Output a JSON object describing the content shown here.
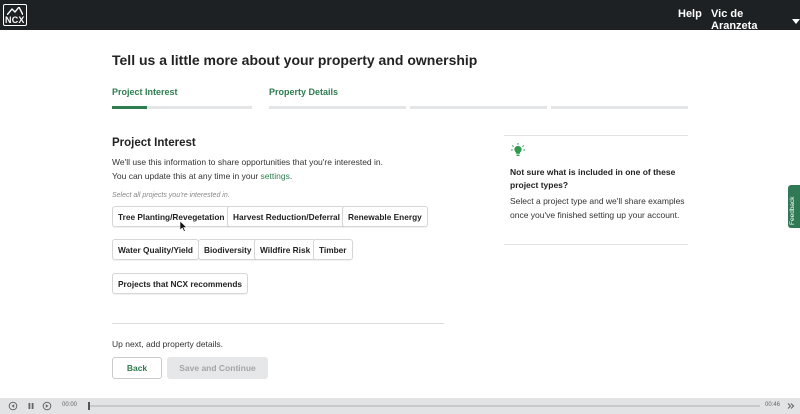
{
  "header": {
    "logo_text": "NCX",
    "help_label": "Help",
    "user_name": "Vic de Aranzeta"
  },
  "page": {
    "title": "Tell us a little more about your property and ownership"
  },
  "steps": [
    {
      "label": "Project Interest",
      "progress": 0.25
    },
    {
      "label": "Property Details",
      "progress": 0
    },
    {
      "label": "",
      "progress": 0
    },
    {
      "label": "",
      "progress": 0
    }
  ],
  "section": {
    "title": "Project Interest",
    "desc_line1": "We'll use this information to share opportunities that you're interested in.",
    "desc_line2_prefix": "You can update this at any time in your ",
    "desc_link": "settings",
    "desc_line2_suffix": ".",
    "hint": "Select all projects you're interested in."
  },
  "projects": [
    "Tree Planting/Revegetation",
    "Harvest Reduction/Deferral",
    "Renewable Energy",
    "Water Quality/Yield",
    "Biodiversity",
    "Wildfire Risk",
    "Timber",
    "Projects that NCX recommends"
  ],
  "footer": {
    "up_next": "Up next, add property details.",
    "back_label": "Back",
    "save_label": "Save and Continue"
  },
  "aside": {
    "icon": "lightbulb-icon",
    "title": "Not sure what is included in one of these project types?",
    "body": "Select a project type and we'll share examples once you've finished setting up your account."
  },
  "feedback_label": "Feedback",
  "player": {
    "current_time": "00:00",
    "duration": "00:46",
    "progress": 0
  },
  "colors": {
    "brand_green": "#2e7d4f",
    "topbar": "#1d2124",
    "feedback_tab": "#2f7a55"
  }
}
